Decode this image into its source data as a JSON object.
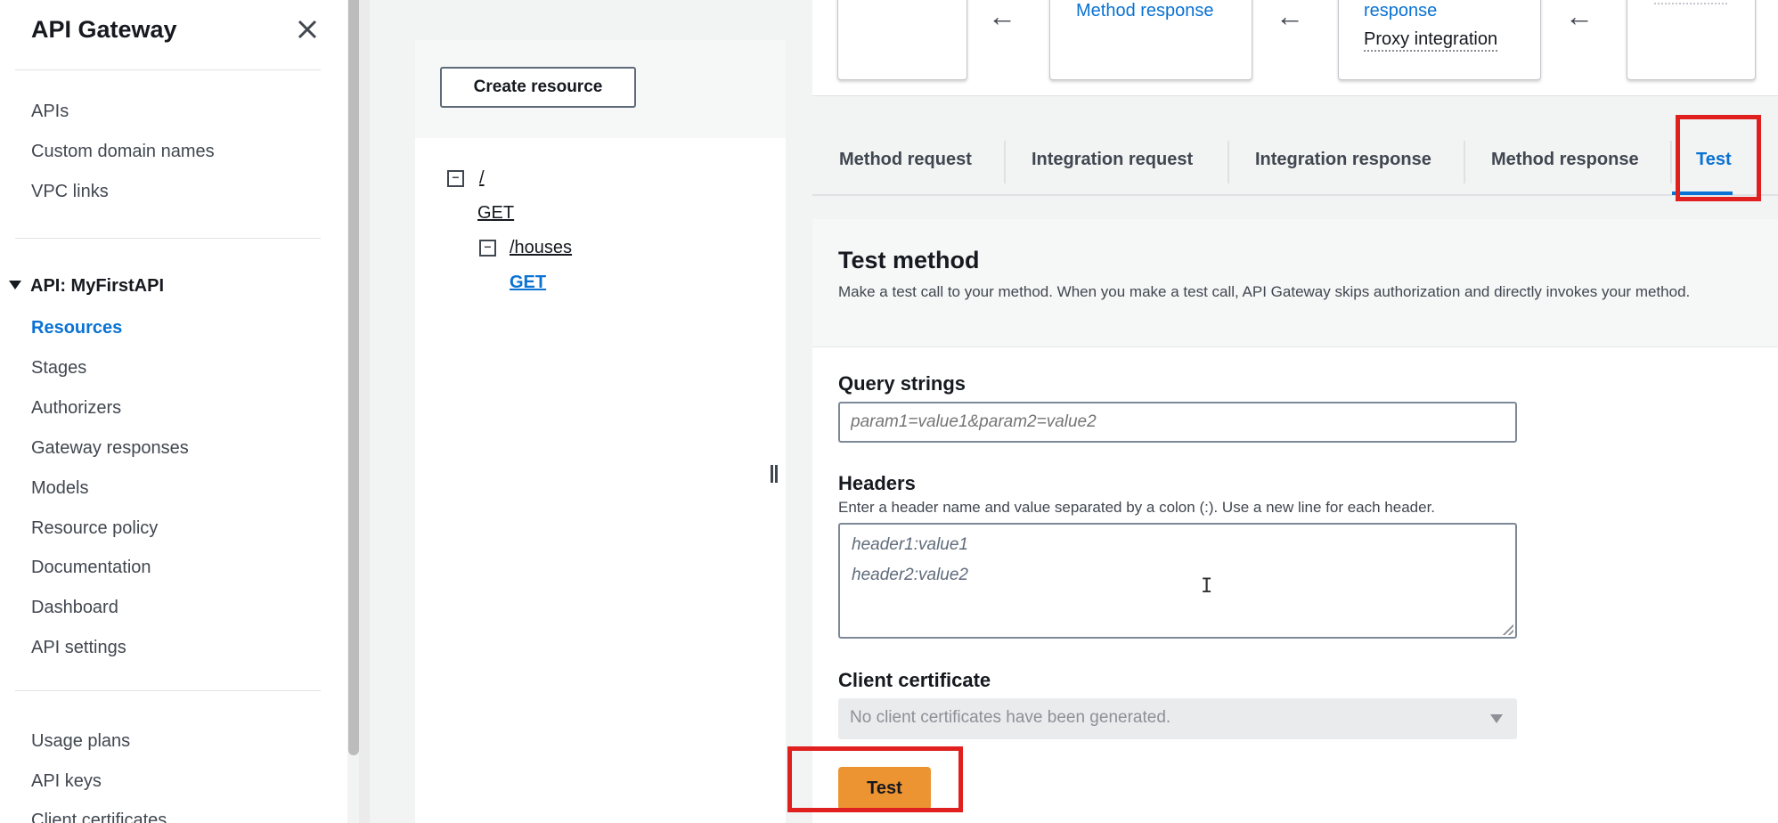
{
  "sidebar": {
    "title": "API Gateway",
    "top_items": [
      "APIs",
      "Custom domain names",
      "VPC links"
    ],
    "section_label": "API: MyFirstAPI",
    "api_items": [
      "Resources",
      "Stages",
      "Authorizers",
      "Gateway responses",
      "Models",
      "Resource policy",
      "Documentation",
      "Dashboard",
      "API settings"
    ],
    "active_item": "Resources",
    "bottom_items": [
      "Usage plans",
      "API keys",
      "Client certificates"
    ]
  },
  "resources": {
    "create_button": "Create resource",
    "tree": {
      "root_path": "/",
      "root_method": "GET",
      "child_path": "/houses",
      "child_method": "GET"
    }
  },
  "flow": {
    "method_response": "Method response",
    "integration_response_tail": "response",
    "proxy_integration": "Proxy integration"
  },
  "tabs": [
    "Method request",
    "Integration request",
    "Integration response",
    "Method response",
    "Test"
  ],
  "active_tab": "Test",
  "test_method": {
    "title": "Test method",
    "description": "Make a test call to your method. When you make a test call, API Gateway skips authorization and directly invokes your method.",
    "query_label": "Query strings",
    "query_placeholder": "param1=value1&param2=value2",
    "headers_label": "Headers",
    "headers_hint": "Enter a header name and value separated by a colon (:). Use a new line for each header.",
    "headers_placeholder_lines": [
      "header1:value1",
      "header2:value2"
    ],
    "cert_label": "Client certificate",
    "cert_value": "No client certificates have been generated.",
    "test_button": "Test"
  },
  "colors": {
    "accent": "#0972d3",
    "primary_button": "#ec9332",
    "highlight": "#e0201e"
  }
}
